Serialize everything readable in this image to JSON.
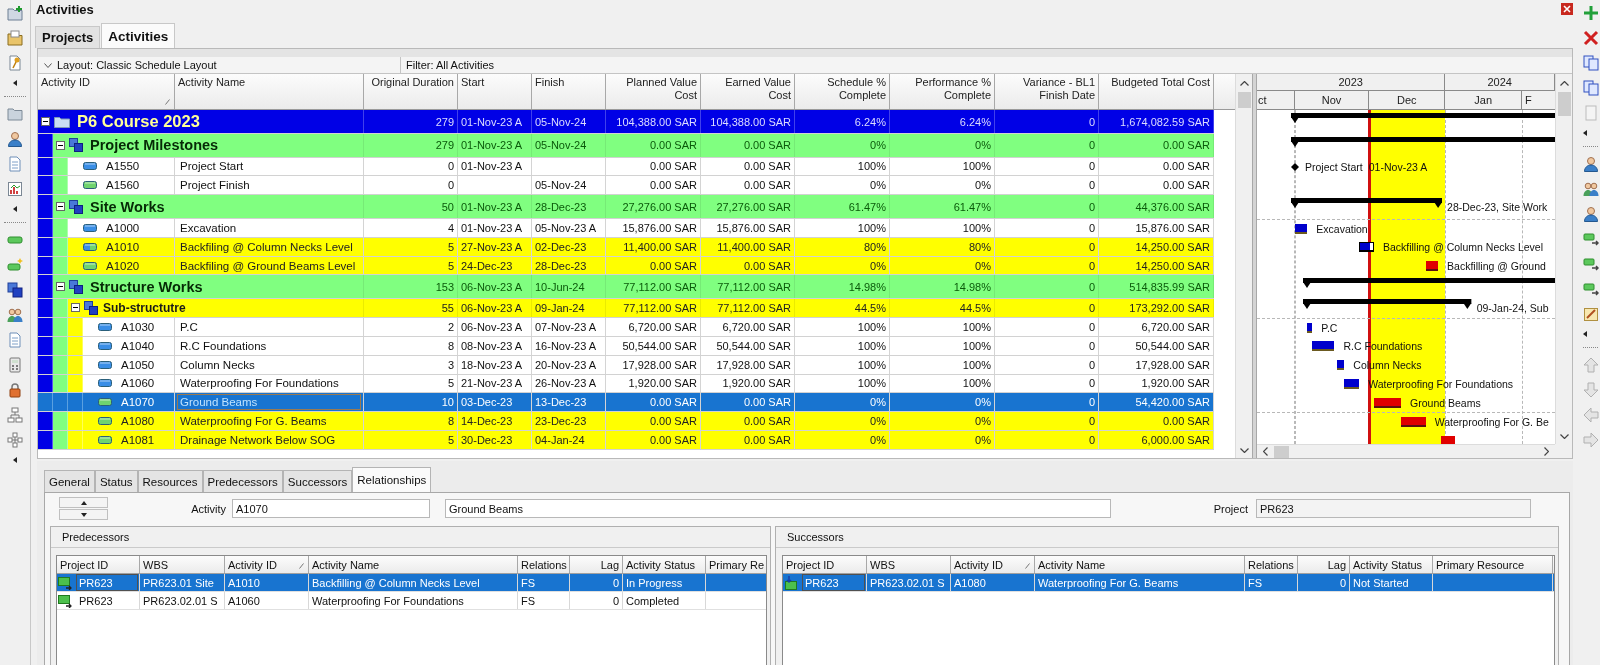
{
  "window": {
    "title": "Activities"
  },
  "tabs": [
    {
      "label": "Projects",
      "selected": false
    },
    {
      "label": "Activities",
      "selected": true
    }
  ],
  "layout_bar": {
    "layout": "Layout: Classic Schedule Layout",
    "filter": "Filter: All Activities"
  },
  "table": {
    "columns": [
      {
        "label": "Activity ID",
        "sorted": true
      },
      {
        "label": "Activity Name",
        "sorted": false
      },
      {
        "label": "Original Duration",
        "sorted": false
      },
      {
        "label": "Start",
        "sorted": false
      },
      {
        "label": "Finish",
        "sorted": false
      },
      {
        "label": "Planned Value\nCost",
        "sorted": false
      },
      {
        "label": "Earned Value\nCost",
        "sorted": false
      },
      {
        "label": "Schedule %\nComplete",
        "sorted": false
      },
      {
        "label": "Performance %\nComplete",
        "sorted": false
      },
      {
        "label": "Variance - BL1\nFinish Date",
        "sorted": false
      },
      {
        "label": "Budgeted Total Cost",
        "sorted": false
      }
    ],
    "rows": [
      {
        "kind": "wbs",
        "name": "P6 Course 2023",
        "expanded": true,
        "selected": false,
        "original_duration": "279",
        "start": "01-Nov-23 A",
        "finish": "05-Nov-24",
        "planned_value_cost": "104,388.00 SAR",
        "earned_value_cost": "104,388.00 SAR",
        "schedule_pct": "6.24%",
        "performance_pct": "6.24%",
        "variance_bl1": "0",
        "budgeted_total_cost": "1,674,082.59 SAR",
        "children": [
          {
            "kind": "wbs",
            "name": "Project Milestones",
            "expanded": true,
            "selected": false,
            "original_duration": "279",
            "start": "01-Nov-23 A",
            "finish": "05-Nov-24",
            "planned_value_cost": "0.00 SAR",
            "earned_value_cost": "0.00 SAR",
            "schedule_pct": "0%",
            "performance_pct": "0%",
            "variance_bl1": "0",
            "budgeted_total_cost": "0.00 SAR",
            "children": [
              {
                "kind": "milestone",
                "id": "A1550",
                "name": "Project Start",
                "started": true,
                "finished": true,
                "highlighted": false,
                "selected": false,
                "original_duration": "0",
                "start": "01-Nov-23 A",
                "planned_value_cost": "0.00 SAR",
                "earned_value_cost": "0.00 SAR",
                "schedule_pct": "100%",
                "performance_pct": "100%",
                "variance_bl1": "0",
                "budgeted_total_cost": "0.00 SAR",
                "bar_labels": [
                  "Project Start",
                  "01-Nov-23 A"
                ]
              },
              {
                "kind": "milestone",
                "id": "A1560",
                "name": "Project Finish",
                "started": false,
                "finished": false,
                "highlighted": false,
                "selected": false,
                "original_duration": "0",
                "finish": "05-Nov-24",
                "planned_value_cost": "0.00 SAR",
                "earned_value_cost": "0.00 SAR",
                "schedule_pct": "0%",
                "performance_pct": "0%",
                "variance_bl1": "0",
                "budgeted_total_cost": "0.00 SAR"
              }
            ]
          },
          {
            "kind": "wbs",
            "name": "Site Works",
            "expanded": true,
            "selected": false,
            "original_duration": "50",
            "start": "01-Nov-23 A",
            "finish": "28-Dec-23",
            "planned_value_cost": "27,276.00 SAR",
            "earned_value_cost": "27,276.00 SAR",
            "schedule_pct": "61.47%",
            "performance_pct": "61.47%",
            "variance_bl1": "0",
            "budgeted_total_cost": "44,376.00 SAR",
            "bar_labels": [
              "28-Dec-23, Site Work"
            ],
            "children": [
              {
                "kind": "task",
                "id": "A1000",
                "name": "Excavation",
                "started": true,
                "finished": true,
                "highlighted": false,
                "selected": false,
                "original_duration": "4",
                "start": "01-Nov-23 A",
                "finish": "05-Nov-23 A",
                "planned_value_cost": "15,876.00 SAR",
                "earned_value_cost": "15,876.00 SAR",
                "schedule_pct": "100%",
                "performance_pct": "100%",
                "variance_bl1": "0",
                "budgeted_total_cost": "15,876.00 SAR",
                "bar_labels": [
                  "Excavation"
                ]
              },
              {
                "kind": "task",
                "id": "A1010",
                "name": "Backfiling @ Column Necks Level",
                "started": true,
                "finished": false,
                "highlighted": true,
                "selected": false,
                "original_duration": "5",
                "start": "27-Nov-23 A",
                "finish": "02-Dec-23",
                "planned_value_cost": "11,400.00 SAR",
                "earned_value_cost": "11,400.00 SAR",
                "schedule_pct": "80%",
                "performance_pct": "80%",
                "variance_bl1": "0",
                "budgeted_total_cost": "14,250.00 SAR",
                "bar_labels": [
                  "Backfilling @ Column Necks Level"
                ]
              },
              {
                "kind": "task",
                "id": "A1020",
                "name": "Backfiling @ Ground Beams Level",
                "started": false,
                "finished": false,
                "highlighted": true,
                "selected": false,
                "original_duration": "5",
                "start": "24-Dec-23",
                "finish": "28-Dec-23",
                "planned_value_cost": "0.00 SAR",
                "earned_value_cost": "0.00 SAR",
                "schedule_pct": "0%",
                "performance_pct": "0%",
                "variance_bl1": "0",
                "budgeted_total_cost": "14,250.00 SAR",
                "bar_labels": [
                  "Backfilling @ Ground"
                ]
              }
            ]
          },
          {
            "kind": "wbs",
            "name": "Structure Works",
            "expanded": true,
            "selected": false,
            "original_duration": "153",
            "start": "06-Nov-23 A",
            "finish": "10-Jun-24",
            "planned_value_cost": "77,112.00 SAR",
            "earned_value_cost": "77,112.00 SAR",
            "schedule_pct": "14.98%",
            "performance_pct": "14.98%",
            "variance_bl1": "0",
            "budgeted_total_cost": "514,835.99 SAR",
            "children": [
              {
                "kind": "wbs",
                "name": "Sub-structutre",
                "expanded": true,
                "selected": false,
                "original_duration": "55",
                "start": "06-Nov-23 A",
                "finish": "09-Jan-24",
                "planned_value_cost": "77,112.00 SAR",
                "earned_value_cost": "77,112.00 SAR",
                "schedule_pct": "44.5%",
                "performance_pct": "44.5%",
                "variance_bl1": "0",
                "budgeted_total_cost": "173,292.00 SAR",
                "bar_labels": [
                  "09-Jan-24, Sub"
                ],
                "children": [
                  {
                    "kind": "task",
                    "id": "A1030",
                    "name": "P.C",
                    "started": true,
                    "finished": true,
                    "highlighted": false,
                    "selected": false,
                    "original_duration": "2",
                    "start": "06-Nov-23 A",
                    "finish": "07-Nov-23 A",
                    "planned_value_cost": "6,720.00 SAR",
                    "earned_value_cost": "6,720.00 SAR",
                    "schedule_pct": "100%",
                    "performance_pct": "100%",
                    "variance_bl1": "0",
                    "budgeted_total_cost": "6,720.00 SAR",
                    "bar_labels": [
                      "P.C"
                    ]
                  },
                  {
                    "kind": "task",
                    "id": "A1040",
                    "name": "R.C Foundations",
                    "started": true,
                    "finished": true,
                    "highlighted": false,
                    "selected": false,
                    "original_duration": "8",
                    "start": "08-Nov-23 A",
                    "finish": "16-Nov-23 A",
                    "planned_value_cost": "50,544.00 SAR",
                    "earned_value_cost": "50,544.00 SAR",
                    "schedule_pct": "100%",
                    "performance_pct": "100%",
                    "variance_bl1": "0",
                    "budgeted_total_cost": "50,544.00 SAR",
                    "bar_labels": [
                      "R.C Foundations"
                    ]
                  },
                  {
                    "kind": "task",
                    "id": "A1050",
                    "name": "Column Necks",
                    "started": true,
                    "finished": true,
                    "highlighted": false,
                    "selected": false,
                    "original_duration": "3",
                    "start": "18-Nov-23 A",
                    "finish": "20-Nov-23 A",
                    "planned_value_cost": "17,928.00 SAR",
                    "earned_value_cost": "17,928.00 SAR",
                    "schedule_pct": "100%",
                    "performance_pct": "100%",
                    "variance_bl1": "0",
                    "budgeted_total_cost": "17,928.00 SAR",
                    "bar_labels": [
                      "Column Necks"
                    ]
                  },
                  {
                    "kind": "task",
                    "id": "A1060",
                    "name": "Waterproofing For Foundations",
                    "started": true,
                    "finished": true,
                    "highlighted": false,
                    "selected": false,
                    "original_duration": "5",
                    "start": "21-Nov-23 A",
                    "finish": "26-Nov-23 A",
                    "planned_value_cost": "1,920.00 SAR",
                    "earned_value_cost": "1,920.00 SAR",
                    "schedule_pct": "100%",
                    "performance_pct": "100%",
                    "variance_bl1": "0",
                    "budgeted_total_cost": "1,920.00 SAR",
                    "bar_labels": [
                      "Waterproofing For Foundations"
                    ]
                  },
                  {
                    "kind": "task",
                    "id": "A1070",
                    "name": "Ground Beams",
                    "started": false,
                    "finished": false,
                    "selected": true,
                    "original_duration": "10",
                    "start": "03-Dec-23",
                    "finish": "13-Dec-23",
                    "planned_value_cost": "0.00 SAR",
                    "earned_value_cost": "0.00 SAR",
                    "schedule_pct": "0%",
                    "performance_pct": "0%",
                    "variance_bl1": "0",
                    "budgeted_total_cost": "54,420.00 SAR",
                    "bar_labels": [
                      "Ground Beams"
                    ]
                  },
                  {
                    "kind": "task",
                    "id": "A1080",
                    "name": "Waterproofing For G. Beams",
                    "started": false,
                    "finished": false,
                    "highlighted": true,
                    "selected": false,
                    "original_duration": "8",
                    "start": "14-Dec-23",
                    "finish": "23-Dec-23",
                    "planned_value_cost": "0.00 SAR",
                    "earned_value_cost": "0.00 SAR",
                    "schedule_pct": "0%",
                    "performance_pct": "0%",
                    "variance_bl1": "0",
                    "budgeted_total_cost": "0.00 SAR",
                    "bar_labels": [
                      "Waterproofing For G. Be"
                    ]
                  },
                  {
                    "kind": "task",
                    "id": "A1081",
                    "name": "Drainage Network Below SOG",
                    "started": false,
                    "finished": false,
                    "highlighted": true,
                    "selected": false,
                    "original_duration": "5",
                    "start": "30-Dec-23",
                    "finish": "04-Jan-24",
                    "planned_value_cost": "0.00 SAR",
                    "earned_value_cost": "0.00 SAR",
                    "schedule_pct": "0%",
                    "performance_pct": "0%",
                    "variance_bl1": "0",
                    "budgeted_total_cost": "6,000.00 SAR"
                  }
                ]
              }
            ]
          }
        ]
      }
    ]
  },
  "gantt": {
    "years": [
      {
        "label": "2023"
      },
      {
        "label": "2024"
      }
    ],
    "months": [
      {
        "label": "ct",
        "highlighted": false
      },
      {
        "label": "Nov",
        "highlighted": false
      },
      {
        "label": "Dec",
        "highlighted": true
      },
      {
        "label": "Jan",
        "highlighted": false
      },
      {
        "label": "F",
        "highlighted": false
      }
    ]
  },
  "details": {
    "tabs": [
      {
        "label": "General",
        "selected": false
      },
      {
        "label": "Status",
        "selected": false
      },
      {
        "label": "Resources",
        "selected": false
      },
      {
        "label": "Predecessors",
        "selected": false
      },
      {
        "label": "Successors",
        "selected": false
      },
      {
        "label": "Relationships",
        "selected": true
      }
    ],
    "activity_label": "Activity",
    "activity_id": "A1070",
    "activity_name": "Ground Beams",
    "project_label": "Project",
    "project_id": "PR623",
    "predecessors": {
      "title": "Predecessors",
      "columns": [
        {
          "label": "Project ID",
          "sorted": false
        },
        {
          "label": "WBS",
          "sorted": false
        },
        {
          "label": "Activity ID",
          "sorted": true
        },
        {
          "label": "Activity Name",
          "sorted": false
        },
        {
          "label": "Relations",
          "sorted": false
        },
        {
          "label": "Lag",
          "sorted": false
        },
        {
          "label": "Activity Status",
          "sorted": false
        },
        {
          "label": "Primary Re",
          "sorted": false
        }
      ],
      "rows": [
        {
          "selected": true,
          "cells": [
            "PR623",
            "PR623.01 Site",
            "A1010",
            "Backfilling @ Column Necks Level",
            "FS",
            "0",
            "In Progress"
          ]
        },
        {
          "selected": false,
          "cells": [
            "PR623",
            "PR623.02.01 S",
            "A1060",
            "Waterproofing For Foundations",
            "FS",
            "0",
            "Completed"
          ]
        }
      ]
    },
    "successors": {
      "title": "Successors",
      "columns": [
        {
          "label": "Project ID",
          "sorted": false
        },
        {
          "label": "WBS",
          "sorted": false
        },
        {
          "label": "Activity ID",
          "sorted": true
        },
        {
          "label": "Activity Name",
          "sorted": false
        },
        {
          "label": "Relations",
          "sorted": false
        },
        {
          "label": "Lag",
          "sorted": false
        },
        {
          "label": "Activity Status",
          "sorted": false
        },
        {
          "label": "Primary Resource",
          "sorted": false
        }
      ],
      "rows": [
        {
          "selected": true,
          "cells": [
            "PR623",
            "PR623.02.01 S",
            "A1080",
            "Waterproofing For G. Beams",
            "FS",
            "0",
            "Not Started"
          ]
        }
      ]
    }
  }
}
